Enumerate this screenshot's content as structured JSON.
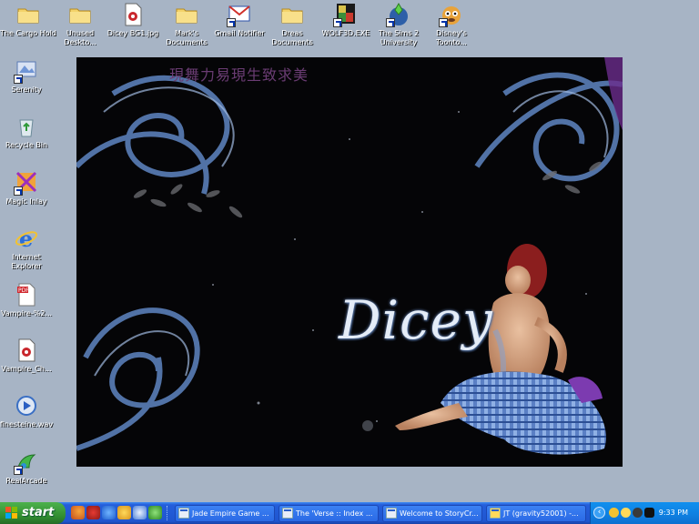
{
  "desktop": {
    "icons_top": [
      {
        "label": "The Cargo Hold",
        "icon": "folder-icon"
      },
      {
        "label": "Unused Deskto...",
        "icon": "folder-icon"
      },
      {
        "label": "Dicey BG1.jpg",
        "icon": "image-file-icon"
      },
      {
        "label": "Mark's Documents",
        "icon": "folder-icon"
      },
      {
        "label": "Gmail Notifier",
        "icon": "gmail-icon"
      },
      {
        "label": "Dreas Documents",
        "icon": "folder-icon"
      },
      {
        "label": "WOLF3D.EXE",
        "icon": "msdos-icon"
      },
      {
        "label": "The Sims 2 University",
        "icon": "sims-icon"
      },
      {
        "label": "Disney's Toonto...",
        "icon": "toontown-icon"
      }
    ],
    "icons_left": [
      {
        "label": "Serenity",
        "icon": "serenity-icon"
      },
      {
        "label": "Recycle Bin",
        "icon": "recycle-bin-icon"
      },
      {
        "label": "Magic Inlay",
        "icon": "magic-inlay-icon"
      },
      {
        "label": "Internet Explorer",
        "icon": "internet-explorer-icon"
      },
      {
        "label": "Vampire-%2...",
        "icon": "pdf-file-icon"
      },
      {
        "label": "Vampire_Ch...",
        "icon": "image-file-icon"
      },
      {
        "label": "finesteine.wav",
        "icon": "audio-file-icon"
      },
      {
        "label": "RealArcade",
        "icon": "realarcade-icon"
      }
    ]
  },
  "wallpaper": {
    "script_text": "現舞力易現生致求美",
    "title": "Dicey"
  },
  "taskbar": {
    "start_label": "start",
    "quick_launch": [
      "firefox-icon",
      "mail-icon",
      "internet-explorer-icon",
      "messenger-icon",
      "media-player-icon",
      "show-desktop-icon"
    ],
    "tasks": [
      {
        "label": "Jade Empire Game ..."
      },
      {
        "label": "The 'Verse :: Index ..."
      },
      {
        "label": "Welcome to StoryCr..."
      },
      {
        "label": "JT (gravity52001) -..."
      }
    ],
    "tray": {
      "icons": [
        "network-icon",
        "messenger-tray-icon",
        "security-icon",
        "dog-icon"
      ],
      "clock": "9:33 PM"
    }
  }
}
